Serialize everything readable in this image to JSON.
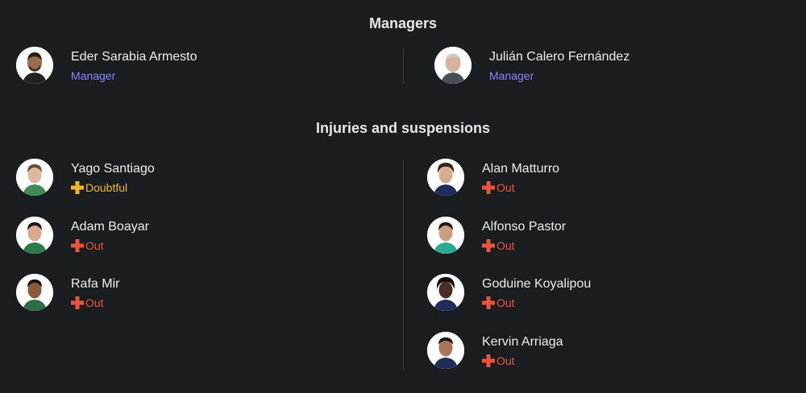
{
  "managers": {
    "title": "Managers",
    "list": [
      {
        "name": "Eder Sarabia Armesto",
        "role": "Manager"
      },
      {
        "name": "Julián Calero Fernández",
        "role": "Manager"
      }
    ]
  },
  "injuries": {
    "title": "Injuries and suspensions",
    "left": [
      {
        "name": "Yago Santiago",
        "status": "Doubtful"
      },
      {
        "name": "Adam Boayar",
        "status": "Out"
      },
      {
        "name": "Rafa Mir",
        "status": "Out"
      }
    ],
    "right": [
      {
        "name": "Alan Matturro",
        "status": "Out"
      },
      {
        "name": "Alfonso Pastor",
        "status": "Out"
      },
      {
        "name": "Goduine Koyalipou",
        "status": "Out"
      },
      {
        "name": "Kervin Arriaga",
        "status": "Out"
      }
    ]
  },
  "colors": {
    "background": "#1b1e21",
    "role": "#8a84ff",
    "out": "#e8553b",
    "doubtful": "#f0b52b"
  }
}
